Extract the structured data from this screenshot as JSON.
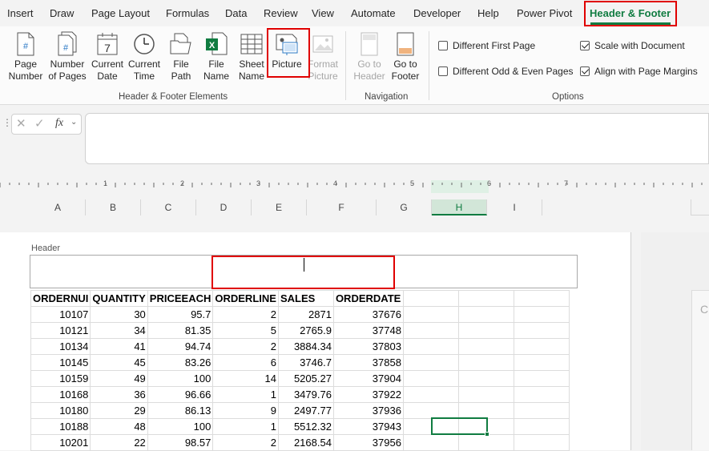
{
  "tabs": [
    "Insert",
    "Draw",
    "Page Layout",
    "Formulas",
    "Data",
    "Review",
    "View",
    "Automate",
    "Developer",
    "Help",
    "Power Pivot",
    "Header & Footer"
  ],
  "active_tab": "Header & Footer",
  "ribbon": {
    "hf_elements": {
      "group_label": "Header & Footer Elements",
      "buttons": [
        {
          "line1": "Page",
          "line2": "Number",
          "icon": "page-number-icon"
        },
        {
          "line1": "Number",
          "line2": "of Pages",
          "icon": "number-of-pages-icon"
        },
        {
          "line1": "Current",
          "line2": "Date",
          "icon": "calendar-icon"
        },
        {
          "line1": "Current",
          "line2": "Time",
          "icon": "clock-icon"
        },
        {
          "line1": "File",
          "line2": "Path",
          "icon": "folder-icon"
        },
        {
          "line1": "File",
          "line2": "Name",
          "icon": "excel-file-icon"
        },
        {
          "line1": "Sheet",
          "line2": "Name",
          "icon": "sheet-grid-icon"
        },
        {
          "line1": "Picture",
          "line2": "",
          "icon": "picture-icon"
        },
        {
          "line1": "Format",
          "line2": "Picture",
          "icon": "format-picture-icon",
          "disabled": true
        }
      ]
    },
    "navigation": {
      "group_label": "Navigation",
      "buttons": [
        {
          "line1": "Go to",
          "line2": "Header",
          "icon": "go-to-header-icon",
          "disabled": true
        },
        {
          "line1": "Go to",
          "line2": "Footer",
          "icon": "go-to-footer-icon"
        }
      ]
    },
    "options": {
      "group_label": "Options",
      "checkboxes": [
        {
          "label": "Different First Page",
          "checked": false
        },
        {
          "label": "Different Odd & Even Pages",
          "checked": false
        },
        {
          "label": "Scale with Document",
          "checked": true
        },
        {
          "label": "Align with Page Margins",
          "checked": true
        }
      ]
    }
  },
  "formula_bar": {
    "fx_label": "fx",
    "value": ""
  },
  "ruler_numbers": [
    "1",
    "2",
    "3",
    "4",
    "5",
    "6",
    "7"
  ],
  "columns": [
    "A",
    "B",
    "C",
    "D",
    "E",
    "F",
    "G",
    "H",
    "I"
  ],
  "selected_column": "H",
  "header_label": "Header",
  "table": {
    "headers": [
      "ORDERNUM",
      "QUANTITY",
      "PRICEEACH",
      "ORDERLINE",
      "SALES",
      "ORDERDATE"
    ],
    "header_display": [
      "ORDERNUI",
      "QUANTITY",
      "PRICEEACH",
      "ORDERLINE",
      "SALES",
      "ORDERDATE"
    ],
    "rows": [
      [
        "10107",
        "30",
        "95.7",
        "2",
        "2871",
        "37676"
      ],
      [
        "10121",
        "34",
        "81.35",
        "5",
        "2765.9",
        "37748"
      ],
      [
        "10134",
        "41",
        "94.74",
        "2",
        "3884.34",
        "37803"
      ],
      [
        "10145",
        "45",
        "83.26",
        "6",
        "3746.7",
        "37858"
      ],
      [
        "10159",
        "49",
        "100",
        "14",
        "5205.27",
        "37904"
      ],
      [
        "10168",
        "36",
        "96.66",
        "1",
        "3479.76",
        "37922"
      ],
      [
        "10180",
        "29",
        "86.13",
        "9",
        "2497.77",
        "37936"
      ],
      [
        "10188",
        "48",
        "100",
        "1",
        "5512.32",
        "37943"
      ],
      [
        "10201",
        "22",
        "98.57",
        "2",
        "2168.54",
        "37956"
      ]
    ]
  },
  "colors": {
    "accent": "#107c41",
    "highlight": "#e00000"
  }
}
